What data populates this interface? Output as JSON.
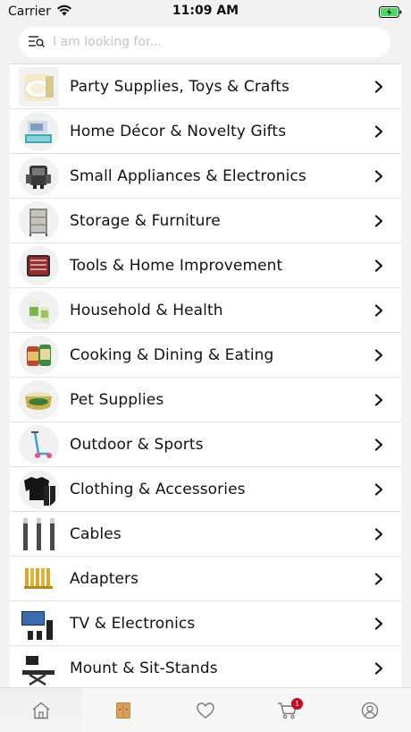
{
  "status_bar": {
    "carrier": "Carrier",
    "time": "11:09 AM"
  },
  "search": {
    "placeholder": "I am looking for..."
  },
  "categories": [
    {
      "label": "Party Supplies, Toys & Crafts",
      "icon": "party-supplies-image"
    },
    {
      "label": "Home Décor & Novelty Gifts",
      "icon": "home-decor-image"
    },
    {
      "label": "Small Appliances & Electronics",
      "icon": "small-appliances-image"
    },
    {
      "label": "Storage & Furniture",
      "icon": "storage-furniture-image"
    },
    {
      "label": "Tools & Home Improvement",
      "icon": "tools-image"
    },
    {
      "label": "Household & Health",
      "icon": "household-health-image"
    },
    {
      "label": "Cooking & Dining & Eating",
      "icon": "cooking-dining-image"
    },
    {
      "label": "Pet Supplies",
      "icon": "pet-supplies-image"
    },
    {
      "label": "Outdoor & Sports",
      "icon": "outdoor-sports-image"
    },
    {
      "label": "Clothing & Accessories",
      "icon": "clothing-image"
    },
    {
      "label": "Cables",
      "icon": "cables-image"
    },
    {
      "label": "Adapters",
      "icon": "adapters-image"
    },
    {
      "label": "TV & Electronics",
      "icon": "tv-electronics-image"
    },
    {
      "label": "Mount & Sit-Stands",
      "icon": "mount-sit-stands-image"
    }
  ],
  "tab_bar": {
    "tabs": [
      {
        "icon": "home-icon"
      },
      {
        "icon": "categories-icon"
      },
      {
        "icon": "heart-icon"
      },
      {
        "icon": "cart-icon",
        "badge": "1"
      },
      {
        "icon": "profile-icon"
      }
    ]
  },
  "colors": {
    "accent": "#d9a05b",
    "badge": "#d0021b",
    "battery": "#4cd964"
  }
}
